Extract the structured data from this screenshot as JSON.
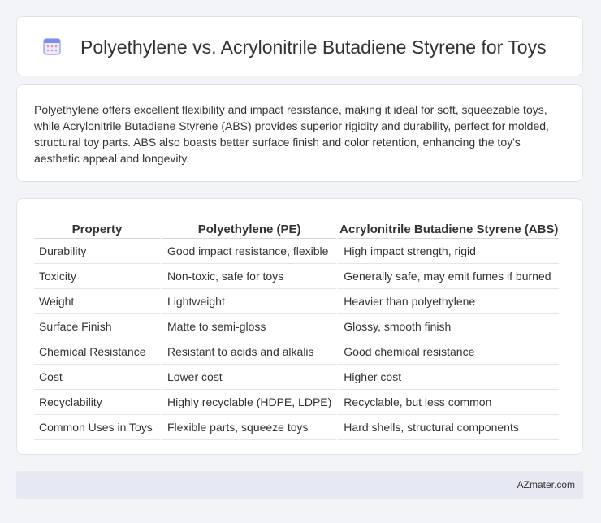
{
  "header": {
    "title": "Polyethylene vs. Acrylonitrile Butadiene Styrene for Toys",
    "icon": "calendar-icon"
  },
  "intro": {
    "text": "Polyethylene offers excellent flexibility and impact resistance, making it ideal for soft, squeezable toys, while Acrylonitrile Butadiene Styrene (ABS) provides superior rigidity and durability, perfect for molded, structural toy parts. ABS also boasts better surface finish and color retention, enhancing the toy's aesthetic appeal and longevity."
  },
  "table": {
    "headers": [
      "Property",
      "Polyethylene (PE)",
      "Acrylonitrile Butadiene Styrene (ABS)"
    ],
    "rows": [
      [
        "Durability",
        "Good impact resistance, flexible",
        "High impact strength, rigid"
      ],
      [
        "Toxicity",
        "Non-toxic, safe for toys",
        "Generally safe, may emit fumes if burned"
      ],
      [
        "Weight",
        "Lightweight",
        "Heavier than polyethylene"
      ],
      [
        "Surface Finish",
        "Matte to semi-gloss",
        "Glossy, smooth finish"
      ],
      [
        "Chemical Resistance",
        "Resistant to acids and alkalis",
        "Good chemical resistance"
      ],
      [
        "Cost",
        "Lower cost",
        "Higher cost"
      ],
      [
        "Recyclability",
        "Highly recyclable (HDPE, LDPE)",
        "Recyclable, but less common"
      ],
      [
        "Common Uses in Toys",
        "Flexible parts, squeeze toys",
        "Hard shells, structural components"
      ]
    ]
  },
  "footer": {
    "brand": "AZmater.com"
  },
  "colors": {
    "icon_primary": "#7b8de8",
    "icon_dots": "#f08db1",
    "background": "#f3f4f8"
  }
}
